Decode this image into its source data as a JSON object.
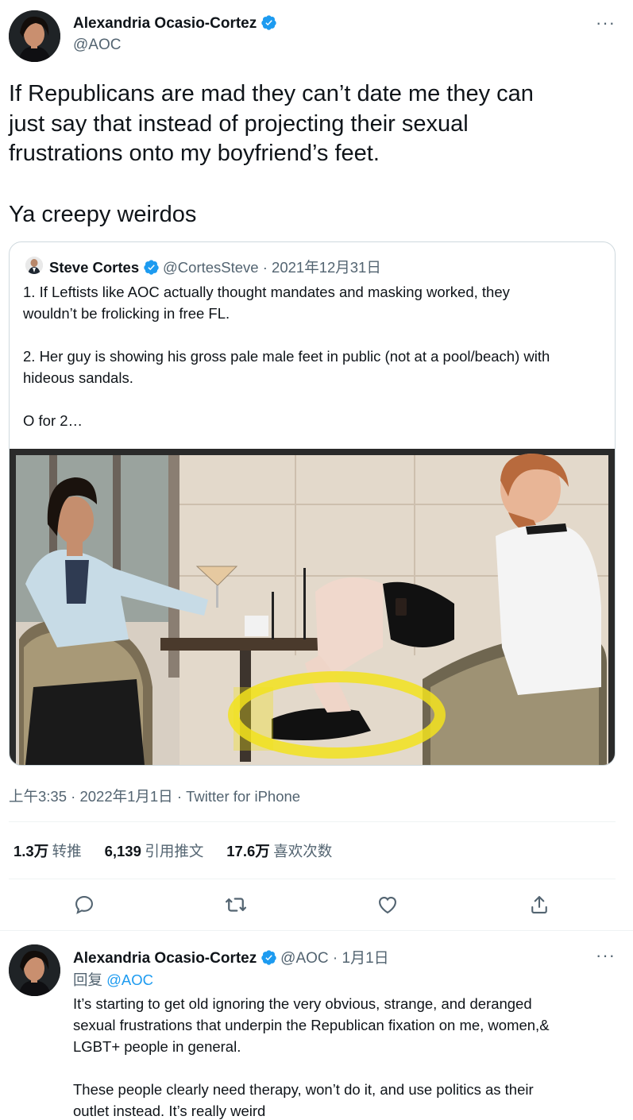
{
  "main_tweet": {
    "author_name": "Alexandria Ocasio-Cortez",
    "author_handle": "@AOC",
    "more_label": "···",
    "text_line1": "If Republicans are mad they can’t date me they can",
    "text_line2": "just say that instead of projecting their sexual",
    "text_line3": "frustrations onto my boyfriend’s feet.",
    "text_line4": "Ya creepy weirdos",
    "timestamp": "上午3:35 · 2022年1月1日 · Twitter for iPhone"
  },
  "quoted_tweet": {
    "author_name": "Steve Cortes",
    "author_handle": "@CortesSteve",
    "date": " · 2021年12月31日",
    "line1": "1. If Leftists like AOC actually thought mandates and masking worked, they",
    "line2": "wouldn’t be frolicking in free FL.",
    "line3": "2. Her guy is showing his gross pale male feet in public (not at a pool/beach) with",
    "line4": "hideous sandals.",
    "line5": "O for 2…"
  },
  "stats": {
    "retweets_num": "1.3万",
    "retweets_label": "转推",
    "quotes_num": "6,139",
    "quotes_label": "引用推文",
    "likes_num": "17.6万",
    "likes_label": "喜欢次数"
  },
  "actions": [
    "reply-icon",
    "retweet-icon",
    "like-icon",
    "share-icon"
  ],
  "reply_tweet": {
    "author_name": "Alexandria Ocasio-Cortez",
    "author_handle": "@AOC",
    "date": " · 1月1日",
    "more_label": "···",
    "replying_prefix": "回复 ",
    "replying_handle": "@AOC",
    "line1": "It’s starting to get old ignoring the very obvious, strange, and deranged",
    "line2": "sexual frustrations that underpin the Republican fixation on me, women,&",
    "line3": "LGBT+ people in general.",
    "line4": "These people clearly need therapy, won’t do it, and use politics as their",
    "line5": "outlet instead. It’s really weird"
  },
  "colors": {
    "accent": "#1d9bf0",
    "secondary_text": "#536471",
    "primary_text": "#0f1419",
    "border": "#cfd9de"
  }
}
